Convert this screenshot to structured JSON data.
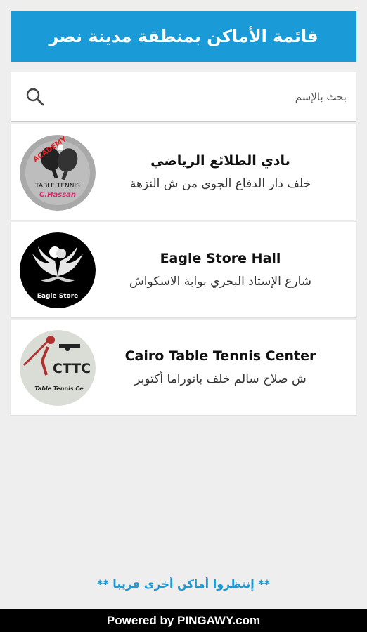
{
  "header": {
    "title": "قائمة الأماكن بمنطقة مدينة نصر"
  },
  "search": {
    "placeholder": "بحث بالإسم",
    "icon": "search-icon"
  },
  "venues": [
    {
      "name": "نادي الطلائع الرياضي",
      "address": "خلف دار الدفاع الجوي من ش النزهة",
      "logo": {
        "top_text": "ACADEMY",
        "line1": "TABLE TENNIS",
        "line2": "C.Hassan"
      }
    },
    {
      "name": "Eagle Store Hall",
      "address": "شارع الإستاد البحري بوابة الاسكواش",
      "logo": {
        "text": "Eagle Store"
      }
    },
    {
      "name": "Cairo Table Tennis Center",
      "address": "ش صلاح سالم خلف بانوراما أكتوبر",
      "logo": {
        "abbr": "CTTC",
        "text": "Table Tennis Ce"
      }
    }
  ],
  "coming_soon": "** إنتظروا أماكن أخرى قريبا **",
  "footer": {
    "text": "Powered by PINGAWY.com"
  },
  "colors": {
    "accent": "#1a9bd7",
    "background": "#eeeeee",
    "footer_bg": "#000000"
  }
}
